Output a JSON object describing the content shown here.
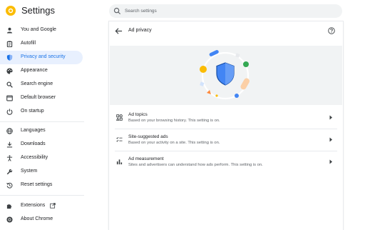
{
  "app": {
    "title": "Settings"
  },
  "search": {
    "placeholder": "Search settings"
  },
  "sidebar": {
    "items": [
      {
        "label": "You and Google",
        "icon": "person-icon"
      },
      {
        "label": "Autofill",
        "icon": "clipboard-icon"
      },
      {
        "label": "Privacy and security",
        "icon": "shield-icon",
        "active": true
      },
      {
        "label": "Appearance",
        "icon": "palette-icon"
      },
      {
        "label": "Search engine",
        "icon": "search-icon"
      },
      {
        "label": "Default browser",
        "icon": "browser-icon"
      },
      {
        "label": "On startup",
        "icon": "power-icon"
      },
      {
        "label": "Languages",
        "icon": "globe-icon"
      },
      {
        "label": "Downloads",
        "icon": "download-icon"
      },
      {
        "label": "Accessibility",
        "icon": "accessibility-icon"
      },
      {
        "label": "System",
        "icon": "wrench-icon"
      },
      {
        "label": "Reset settings",
        "icon": "reset-icon"
      },
      {
        "label": "Extensions",
        "icon": "puzzle-icon"
      },
      {
        "label": "About Chrome",
        "icon": "chrome-icon"
      }
    ]
  },
  "page": {
    "title": "Ad privacy"
  },
  "rows": [
    {
      "title": "Ad topics",
      "description": "Based on your browsing history. This setting is on.",
      "icon": "topics-icon"
    },
    {
      "title": "Site-suggested ads",
      "description": "Based on your activity on a site. This setting is on.",
      "icon": "checklist-icon"
    },
    {
      "title": "Ad measurement",
      "description": "Sites and advertisers can understand how ads perform. This setting is on.",
      "icon": "bar-chart-icon"
    }
  ],
  "colors": {
    "accent": "#1a73e8",
    "active_bg": "#e8f0fe",
    "hero_bg": "#f1f3f4",
    "shield": "#4285f4"
  }
}
